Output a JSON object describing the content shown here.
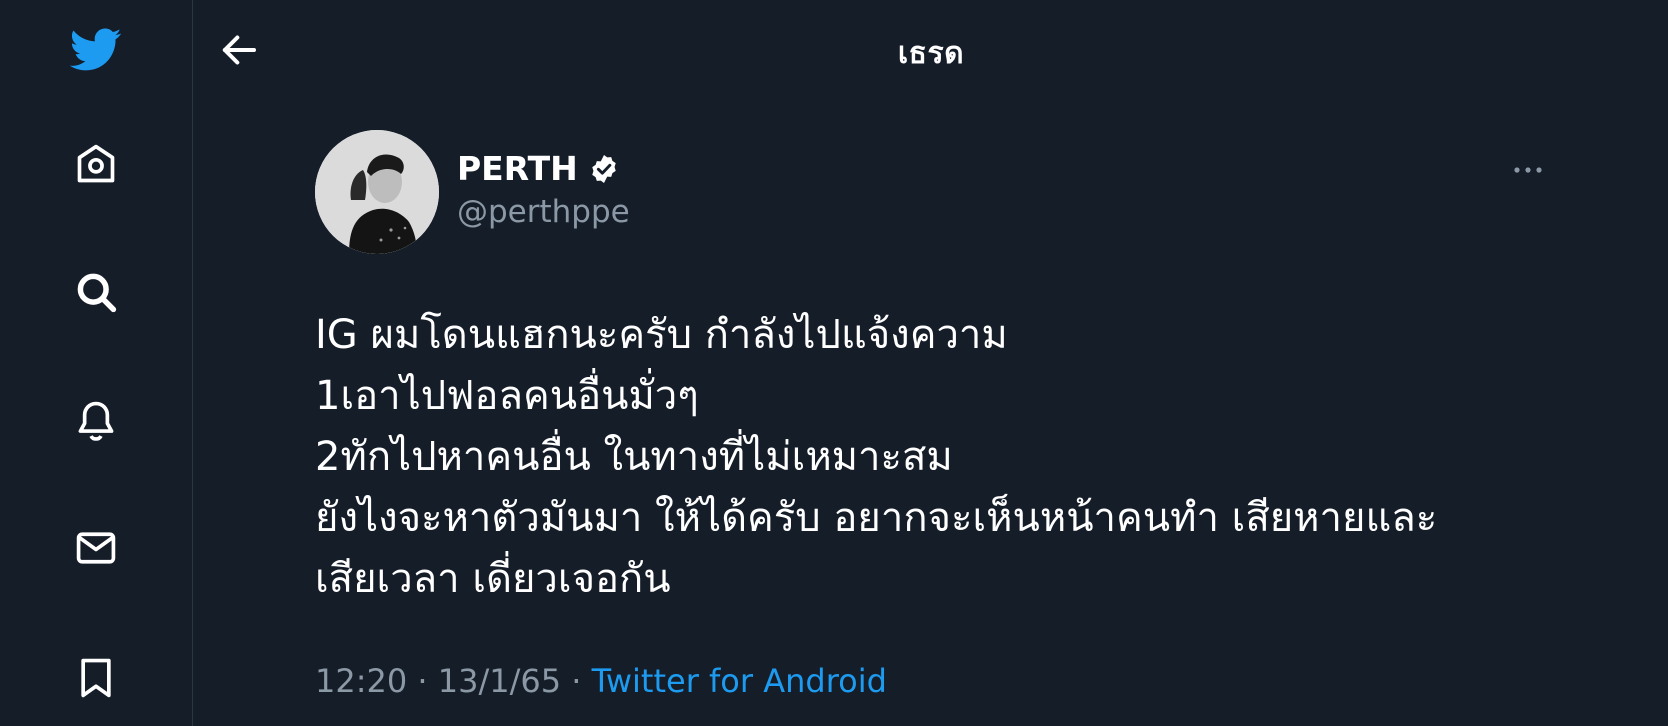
{
  "header": {
    "title": "เธรด"
  },
  "tweet": {
    "author_name": "PERTH",
    "author_handle": "@perthppe",
    "lines": [
      "IG ผมโดนแฮกนะครับ กำลังไปแจ้งความ",
      "1เอาไปฟอลคนอื่นมั่วๆ",
      "2ทักไปหาคนอื่น ในทางที่ไม่เหมาะสม",
      "ยังไงจะหาตัวมันมา ให้ได้ครับ อยากจะเห็นหน้าคนทำ เสียหายและ",
      "เสียเวลา เดี่ยวเจอกัน"
    ],
    "time": "12:20",
    "separator": " · ",
    "date": "13/1/65",
    "source": "Twitter for Android"
  },
  "colors": {
    "background": "#151d29",
    "text": "#ffffff",
    "secondary": "#8b98a5",
    "accent": "#1d9bf0"
  },
  "icons": {
    "sidebar": [
      "twitter-logo-icon",
      "home-icon",
      "search-icon",
      "notifications-bell-icon",
      "messages-mail-icon",
      "bookmark-icon"
    ],
    "header": "back-arrow-icon",
    "tweet": [
      "verified-badge-icon",
      "more-options-icon"
    ]
  }
}
